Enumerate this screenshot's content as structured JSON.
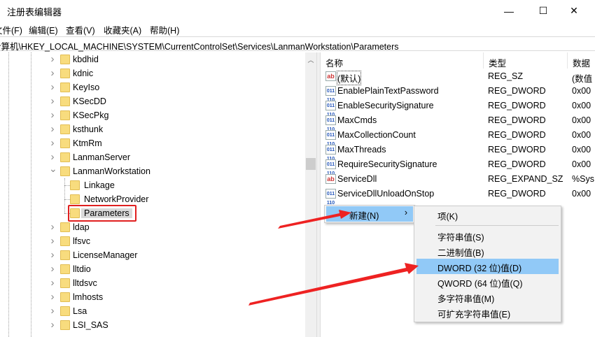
{
  "window": {
    "title": "注册表编辑器",
    "minimize": "—",
    "maximize": "☐",
    "close": "✕"
  },
  "menu": [
    "文件(F)",
    "编辑(E)",
    "查看(V)",
    "收藏夹(A)",
    "帮助(H)"
  ],
  "address": "计算机\\HKEY_LOCAL_MACHINE\\SYSTEM\\CurrentControlSet\\Services\\LanmanWorkstation\\Parameters",
  "tree": [
    {
      "label": "kbdhid",
      "level": 0,
      "state": "collapsed"
    },
    {
      "label": "kdnic",
      "level": 0,
      "state": "collapsed"
    },
    {
      "label": "KeyIso",
      "level": 0,
      "state": "collapsed"
    },
    {
      "label": "KSecDD",
      "level": 0,
      "state": "collapsed"
    },
    {
      "label": "KSecPkg",
      "level": 0,
      "state": "collapsed"
    },
    {
      "label": "ksthunk",
      "level": 0,
      "state": "collapsed"
    },
    {
      "label": "KtmRm",
      "level": 0,
      "state": "collapsed"
    },
    {
      "label": "LanmanServer",
      "level": 0,
      "state": "collapsed"
    },
    {
      "label": "LanmanWorkstation",
      "level": 0,
      "state": "expanded"
    },
    {
      "label": "Linkage",
      "level": 1,
      "state": "leaf"
    },
    {
      "label": "NetworkProvider",
      "level": 1,
      "state": "leaf"
    },
    {
      "label": "Parameters",
      "level": 1,
      "state": "selected"
    },
    {
      "label": "ldap",
      "level": 0,
      "state": "collapsed"
    },
    {
      "label": "lfsvc",
      "level": 0,
      "state": "collapsed"
    },
    {
      "label": "LicenseManager",
      "level": 0,
      "state": "collapsed"
    },
    {
      "label": "lltdio",
      "level": 0,
      "state": "collapsed"
    },
    {
      "label": "lltdsvc",
      "level": 0,
      "state": "collapsed"
    },
    {
      "label": "lmhosts",
      "level": 0,
      "state": "collapsed"
    },
    {
      "label": "Lsa",
      "level": 0,
      "state": "collapsed"
    },
    {
      "label": "LSI_SAS",
      "level": 0,
      "state": "collapsed"
    }
  ],
  "list": {
    "headers": {
      "name": "名称",
      "type": "类型",
      "data": "数据"
    },
    "rows": [
      {
        "icon": "ab",
        "name": "(默认)",
        "type": "REG_SZ",
        "data": "(数值"
      },
      {
        "icon": "bin",
        "name": "EnablePlainTextPassword",
        "type": "REG_DWORD",
        "data": "0x00"
      },
      {
        "icon": "bin",
        "name": "EnableSecuritySignature",
        "type": "REG_DWORD",
        "data": "0x00"
      },
      {
        "icon": "bin",
        "name": "MaxCmds",
        "type": "REG_DWORD",
        "data": "0x00"
      },
      {
        "icon": "bin",
        "name": "MaxCollectionCount",
        "type": "REG_DWORD",
        "data": "0x00"
      },
      {
        "icon": "bin",
        "name": "MaxThreads",
        "type": "REG_DWORD",
        "data": "0x00"
      },
      {
        "icon": "bin",
        "name": "RequireSecuritySignature",
        "type": "REG_DWORD",
        "data": "0x00"
      },
      {
        "icon": "ab",
        "name": "ServiceDll",
        "type": "REG_EXPAND_SZ",
        "data": "%Sys"
      },
      {
        "icon": "bin",
        "name": "ServiceDllUnloadOnStop",
        "type": "REG_DWORD",
        "data": "0x00"
      }
    ]
  },
  "context_menu": {
    "new": "新建(N)",
    "arrow": "›"
  },
  "submenu": {
    "key": "项(K)",
    "items": [
      "字符串值(S)",
      "二进制值(B)",
      "DWORD (32 位)值(D)",
      "QWORD (64 位)值(Q)",
      "多字符串值(M)",
      "可扩充字符串值(E)"
    ],
    "highlighted": 2
  },
  "colors": {
    "highlight": "#91c9f7",
    "annotation": "#ee2222"
  }
}
